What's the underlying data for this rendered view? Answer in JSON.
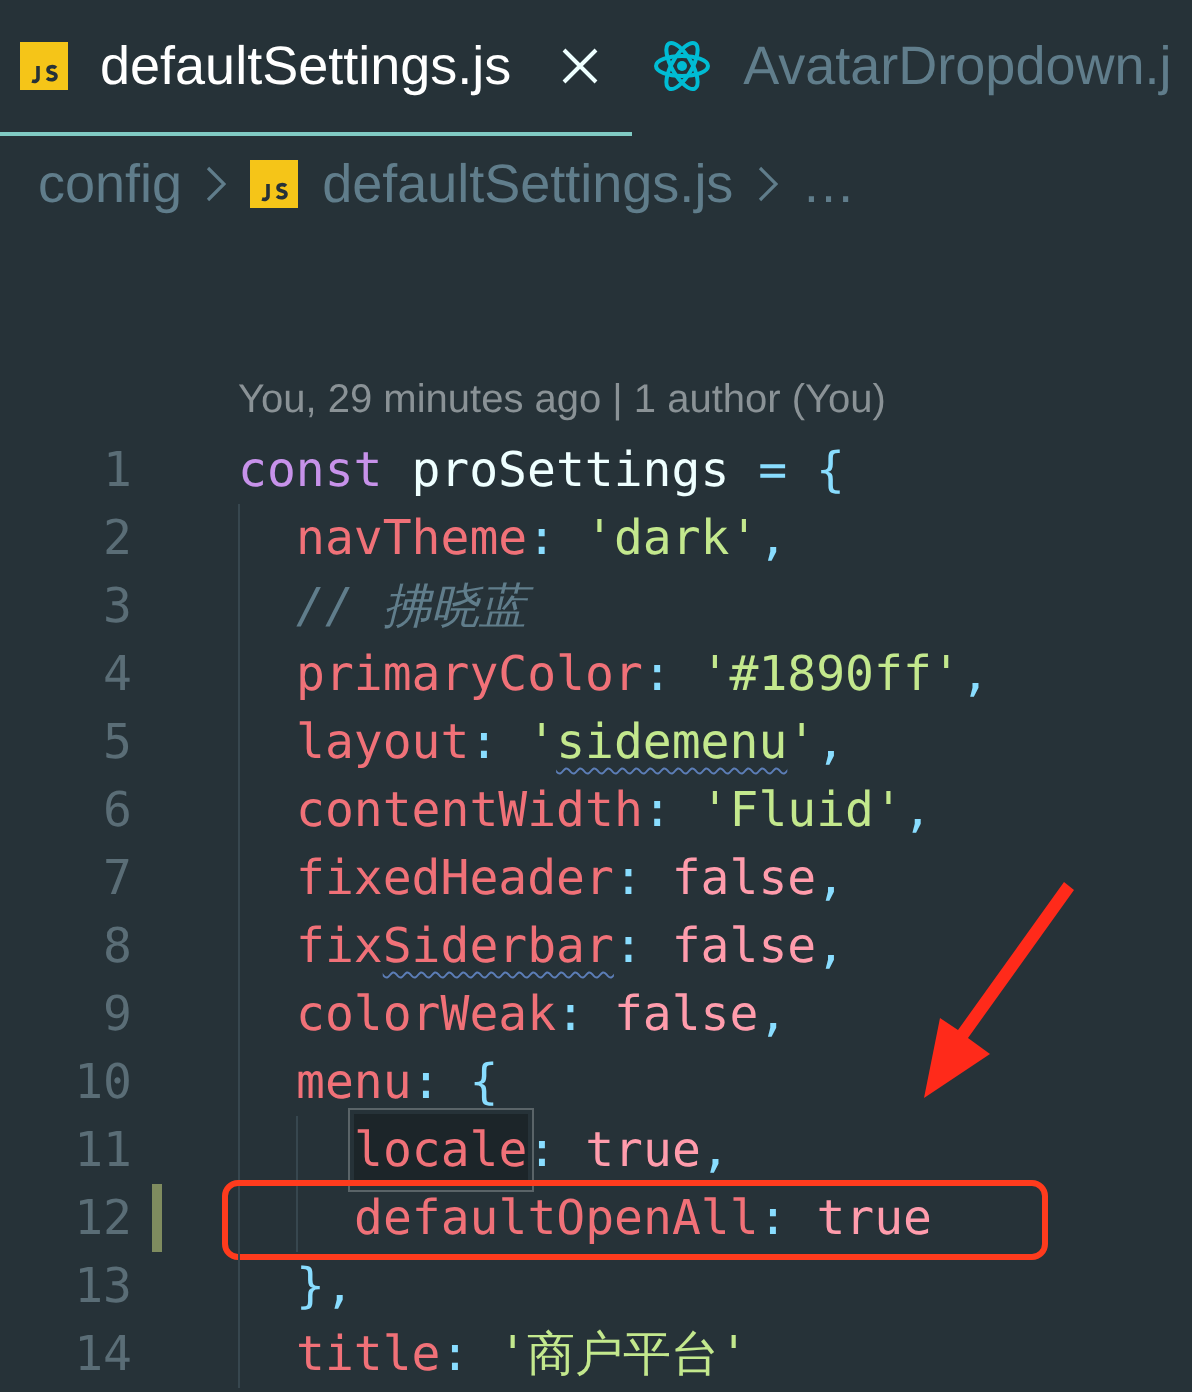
{
  "tabs": [
    {
      "label": "defaultSettings.js",
      "kind": "script",
      "selected": true,
      "closable": true
    },
    {
      "label": "AvatarDropdown.j",
      "kind": "component",
      "selected": false,
      "closable": false
    }
  ],
  "breadcrumb": [
    {
      "label": "config",
      "kind": "folder"
    },
    {
      "label": "defaultSettings.js",
      "kind": "script"
    },
    {
      "label": "…",
      "kind": "more"
    }
  ],
  "codelens": "You, 29 minutes ago | 1 author (You)",
  "lines": [
    {
      "number": "1",
      "modified": false,
      "annotated": false,
      "tokens": [
        {
          "kind": "keyword",
          "text": "const"
        },
        {
          "kind": "ident",
          "text": " proSettings "
        },
        {
          "kind": "punct",
          "text": "= {"
        }
      ],
      "children": [
        {
          "number": "2",
          "modified": false,
          "annotated": false,
          "tokens": [
            {
              "kind": "prop",
              "text": "navTheme"
            },
            {
              "kind": "punct",
              "text": ": "
            },
            {
              "kind": "string",
              "text": "'dark'"
            },
            {
              "kind": "punct",
              "text": ","
            }
          ]
        },
        {
          "number": "3",
          "modified": false,
          "annotated": false,
          "tokens": [
            {
              "kind": "comment",
              "text": "// 拂晓蓝"
            }
          ]
        },
        {
          "number": "4",
          "modified": false,
          "annotated": false,
          "tokens": [
            {
              "kind": "prop",
              "text": "primaryColor"
            },
            {
              "kind": "punct",
              "text": ": "
            },
            {
              "kind": "string",
              "text": "'#1890ff'"
            },
            {
              "kind": "punct",
              "text": ","
            }
          ]
        },
        {
          "number": "5",
          "modified": false,
          "annotated": false,
          "tokens": [
            {
              "kind": "prop",
              "text": "layout"
            },
            {
              "kind": "punct",
              "text": ": "
            },
            {
              "kind": "string",
              "text": "'"
            },
            {
              "kind": "string",
              "text": "sidemenu",
              "squiggle": true
            },
            {
              "kind": "string",
              "text": "'"
            },
            {
              "kind": "punct",
              "text": ","
            }
          ]
        },
        {
          "number": "6",
          "modified": false,
          "annotated": false,
          "tokens": [
            {
              "kind": "prop",
              "text": "contentWidth"
            },
            {
              "kind": "punct",
              "text": ": "
            },
            {
              "kind": "string",
              "text": "'Fluid'"
            },
            {
              "kind": "punct",
              "text": ","
            }
          ]
        },
        {
          "number": "7",
          "modified": false,
          "annotated": false,
          "tokens": [
            {
              "kind": "prop",
              "text": "fixedHeader"
            },
            {
              "kind": "punct",
              "text": ": "
            },
            {
              "kind": "bool",
              "text": "false"
            },
            {
              "kind": "punct",
              "text": ","
            }
          ]
        },
        {
          "number": "8",
          "modified": false,
          "annotated": false,
          "tokens": [
            {
              "kind": "prop",
              "text": "fix"
            },
            {
              "kind": "prop",
              "text": "Siderbar",
              "squiggle": true
            },
            {
              "kind": "punct",
              "text": ": "
            },
            {
              "kind": "bool",
              "text": "false"
            },
            {
              "kind": "punct",
              "text": ","
            }
          ]
        },
        {
          "number": "9",
          "modified": false,
          "annotated": false,
          "tokens": [
            {
              "kind": "prop",
              "text": "colorWeak"
            },
            {
              "kind": "punct",
              "text": ": "
            },
            {
              "kind": "bool",
              "text": "false"
            },
            {
              "kind": "punct",
              "text": ","
            }
          ]
        },
        {
          "number": "10",
          "modified": false,
          "annotated": false,
          "tokens": [
            {
              "kind": "prop",
              "text": "menu"
            },
            {
              "kind": "punct",
              "text": ": {"
            }
          ],
          "children": [
            {
              "number": "11",
              "modified": false,
              "annotated": false,
              "tokens": [
                {
                  "kind": "prop",
                  "text": "locale",
                  "boxed": true
                },
                {
                  "kind": "punct",
                  "text": ": "
                },
                {
                  "kind": "bool",
                  "text": "true"
                },
                {
                  "kind": "punct",
                  "text": ","
                }
              ]
            },
            {
              "number": "12",
              "modified": true,
              "annotated": true,
              "tokens": [
                {
                  "kind": "prop",
                  "text": "defaultOpenAll"
                },
                {
                  "kind": "punct",
                  "text": ": "
                },
                {
                  "kind": "bool",
                  "text": "true"
                }
              ]
            }
          ]
        },
        {
          "number": "13",
          "modified": false,
          "annotated": false,
          "tokens": [
            {
              "kind": "punct",
              "text": "},"
            }
          ]
        },
        {
          "number": "14",
          "modified": false,
          "annotated": false,
          "tokens": [
            {
              "kind": "prop",
              "text": "title"
            },
            {
              "kind": "punct",
              "text": ": "
            },
            {
              "kind": "string",
              "text": "'商户平台'"
            }
          ]
        }
      ]
    }
  ]
}
